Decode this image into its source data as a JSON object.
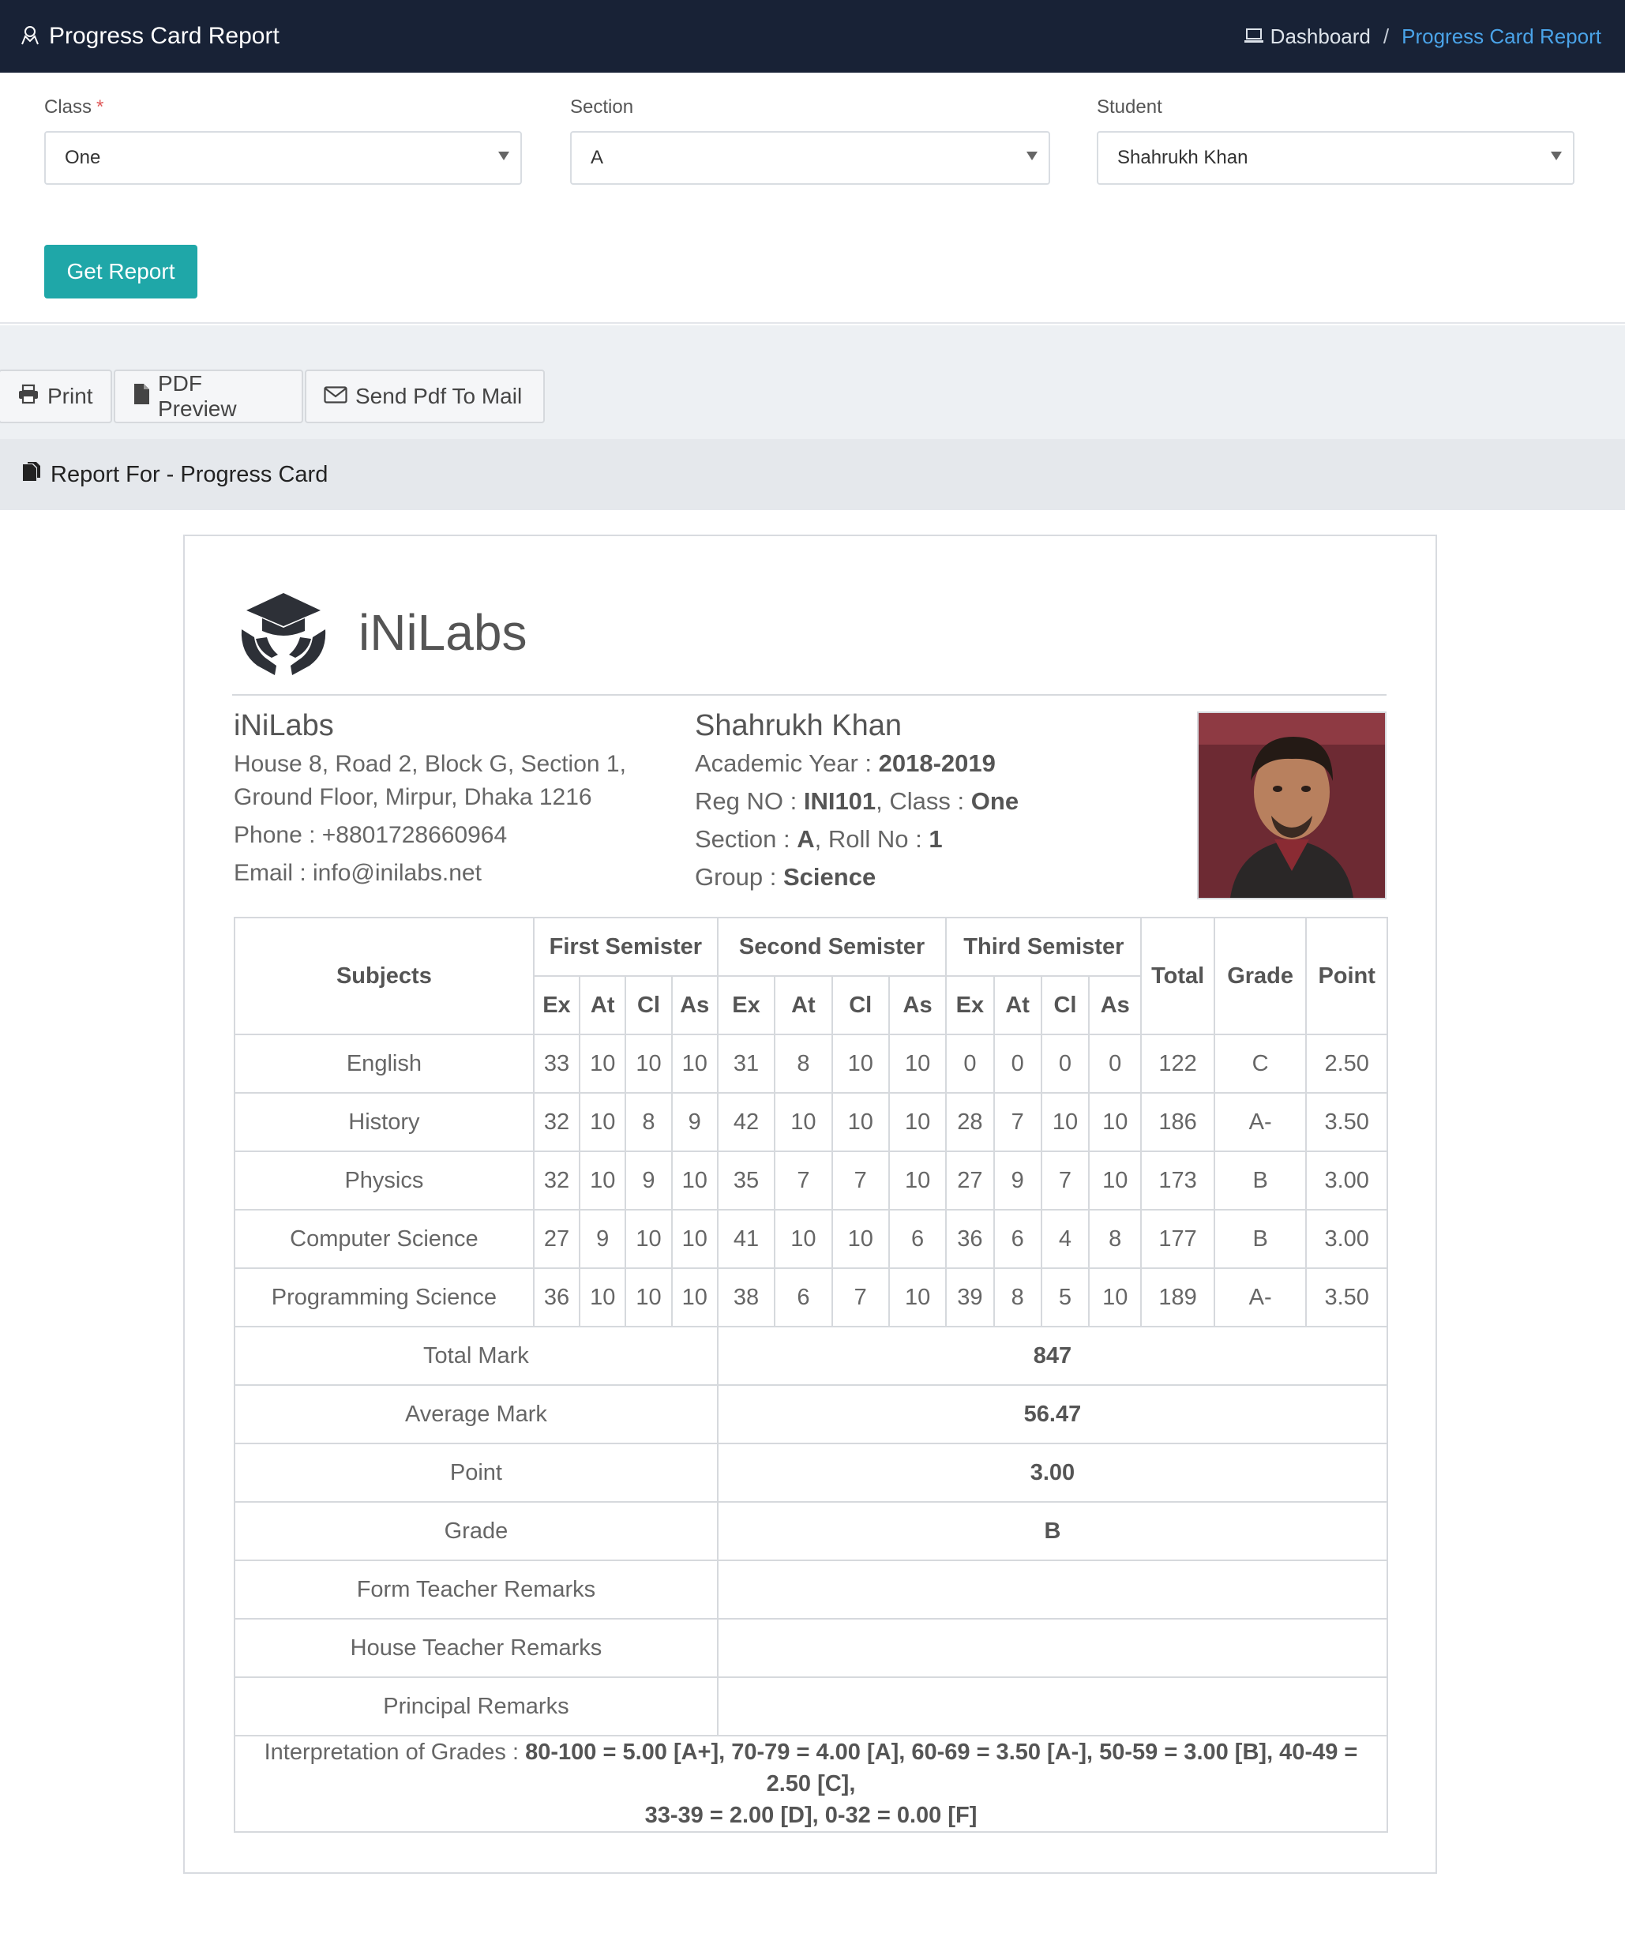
{
  "topbar": {
    "title": "Progress Card Report",
    "breadcrumb_home": "Dashboard",
    "breadcrumb_sep": "/",
    "breadcrumb_active": "Progress Card Report"
  },
  "filters": {
    "class_label": "Class",
    "class_required": "*",
    "class_value": "One",
    "section_label": "Section",
    "section_value": "A",
    "student_label": "Student",
    "student_value": "Shahrukh Khan",
    "get_report_label": "Get Report"
  },
  "actions": {
    "print_label": "Print",
    "pdf_preview_label": "PDF Preview",
    "send_mail_label": "Send Pdf To Mail"
  },
  "report": {
    "heading": "Report For - Progress Card",
    "logo_text": "iNiLabs",
    "school": {
      "name": "iNiLabs",
      "address_1": "House 8, Road 2, Block G, Section 1,",
      "address_2": "Ground Floor, Mirpur, Dhaka 1216",
      "phone": "Phone : +8801728660964",
      "email": "Email : info@inilabs.net"
    },
    "student": {
      "name": "Shahrukh Khan",
      "academic_year_label": "Academic Year : ",
      "academic_year": "2018-2019",
      "reg_label": "Reg NO : ",
      "reg_no": "INI101",
      "class_label": ", Class : ",
      "class": "One",
      "section_label": "Section : ",
      "section": "A",
      "roll_label": ", Roll No : ",
      "roll": "1",
      "group_label": "Group : ",
      "group": "Science"
    },
    "table": {
      "subjects_header": "Subjects",
      "semesters": [
        "First Semister",
        "Second Semister",
        "Third Semister"
      ],
      "sub_headers": [
        "Ex",
        "At",
        "Cl",
        "As"
      ],
      "total_header": "Total",
      "grade_header": "Grade",
      "point_header": "Point",
      "rows": [
        {
          "subject": "English",
          "marks": [
            "33",
            "10",
            "10",
            "10",
            "31",
            "8",
            "10",
            "10",
            "0",
            "0",
            "0",
            "0"
          ],
          "total": "122",
          "grade": "C",
          "point": "2.50"
        },
        {
          "subject": "History",
          "marks": [
            "32",
            "10",
            "8",
            "9",
            "42",
            "10",
            "10",
            "10",
            "28",
            "7",
            "10",
            "10"
          ],
          "total": "186",
          "grade": "A-",
          "point": "3.50"
        },
        {
          "subject": "Physics",
          "marks": [
            "32",
            "10",
            "9",
            "10",
            "35",
            "7",
            "7",
            "10",
            "27",
            "9",
            "7",
            "10"
          ],
          "total": "173",
          "grade": "B",
          "point": "3.00"
        },
        {
          "subject": "Computer Science",
          "marks": [
            "27",
            "9",
            "10",
            "10",
            "41",
            "10",
            "10",
            "6",
            "36",
            "6",
            "4",
            "8"
          ],
          "total": "177",
          "grade": "B",
          "point": "3.00"
        },
        {
          "subject": "Programming Science",
          "marks": [
            "36",
            "10",
            "10",
            "10",
            "38",
            "6",
            "7",
            "10",
            "39",
            "8",
            "5",
            "10"
          ],
          "total": "189",
          "grade": "A-",
          "point": "3.50"
        }
      ],
      "summary": [
        {
          "label": "Total Mark",
          "value": "847"
        },
        {
          "label": "Average Mark",
          "value": "56.47"
        },
        {
          "label": "Point",
          "value": "3.00"
        },
        {
          "label": "Grade",
          "value": "B"
        },
        {
          "label": "Form Teacher Remarks",
          "value": ""
        },
        {
          "label": "House Teacher Remarks",
          "value": ""
        },
        {
          "label": "Principal Remarks",
          "value": ""
        }
      ],
      "interpretation_label": "Interpretation of Grades : ",
      "interpretation_line1": "80-100 = 5.00 [A+], 70-79 = 4.00 [A], 60-69 = 3.50 [A-], 50-59 = 3.00 [B], 40-49 = 2.50 [C],",
      "interpretation_line2": "33-39 = 2.00 [D], 0-32 = 0.00 [F]"
    }
  }
}
